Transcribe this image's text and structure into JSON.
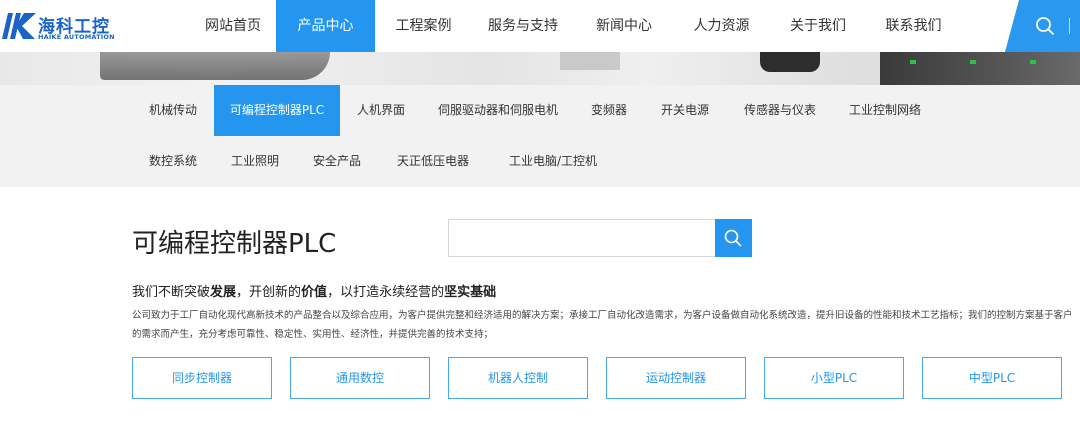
{
  "logo": {
    "cn": "海科工控",
    "en": "HAIKE AUTOMATION",
    "brand_color": "#1a64c8"
  },
  "nav": {
    "items": [
      {
        "label": "网站首页",
        "active": false
      },
      {
        "label": "产品中心",
        "active": true
      },
      {
        "label": "工程案例",
        "active": false
      },
      {
        "label": "服务与支持",
        "active": false
      },
      {
        "label": "新闻中心",
        "active": false
      },
      {
        "label": "人力资源",
        "active": false
      },
      {
        "label": "关于我们",
        "active": false
      },
      {
        "label": "联系我们",
        "active": false
      }
    ],
    "search_icon": "search-icon",
    "accent_color": "#2596f0"
  },
  "categories": {
    "row1": [
      {
        "label": "机械传动",
        "active": false
      },
      {
        "label": "可编程控制器PLC",
        "active": true
      },
      {
        "label": "人机界面",
        "active": false
      },
      {
        "label": "伺服驱动器和伺服电机",
        "active": false
      },
      {
        "label": "变频器",
        "active": false
      },
      {
        "label": "开关电源",
        "active": false
      },
      {
        "label": "传感器与仪表",
        "active": false
      },
      {
        "label": "工业控制网络",
        "active": false
      }
    ],
    "row2": [
      {
        "label": "数控系统",
        "active": false
      },
      {
        "label": "工业照明",
        "active": false
      },
      {
        "label": "安全产品",
        "active": false
      },
      {
        "label": "天正低压电器",
        "active": false
      },
      {
        "label": "工业电脑/工控机",
        "active": false
      }
    ]
  },
  "main": {
    "title": "可编程控制器PLC",
    "search": {
      "value": "",
      "placeholder": ""
    },
    "slogan": {
      "p1": "我们不断突破",
      "b1": "发展",
      "p2": "，开创新的",
      "b2": "价值",
      "p3": "，以打造永续经营的",
      "b3": "坚实基础"
    },
    "description": "公司致力于工厂自动化现代高新技术的产品整合以及综合应用，为客户提供完整和经济适用的解决方案；承接工厂自动化改造需求，为客户设备做自动化系统改造，提升旧设备的性能和技术工艺指标；我们的控制方案基于客户的需求而产生，充分考虑可靠性、稳定性、实用性、经济性，并提供完善的技术支持；",
    "sub_categories": [
      "同步控制器",
      "通用数控",
      "机器人控制",
      "运动控制器",
      "小型PLC",
      "中型PLC"
    ]
  }
}
